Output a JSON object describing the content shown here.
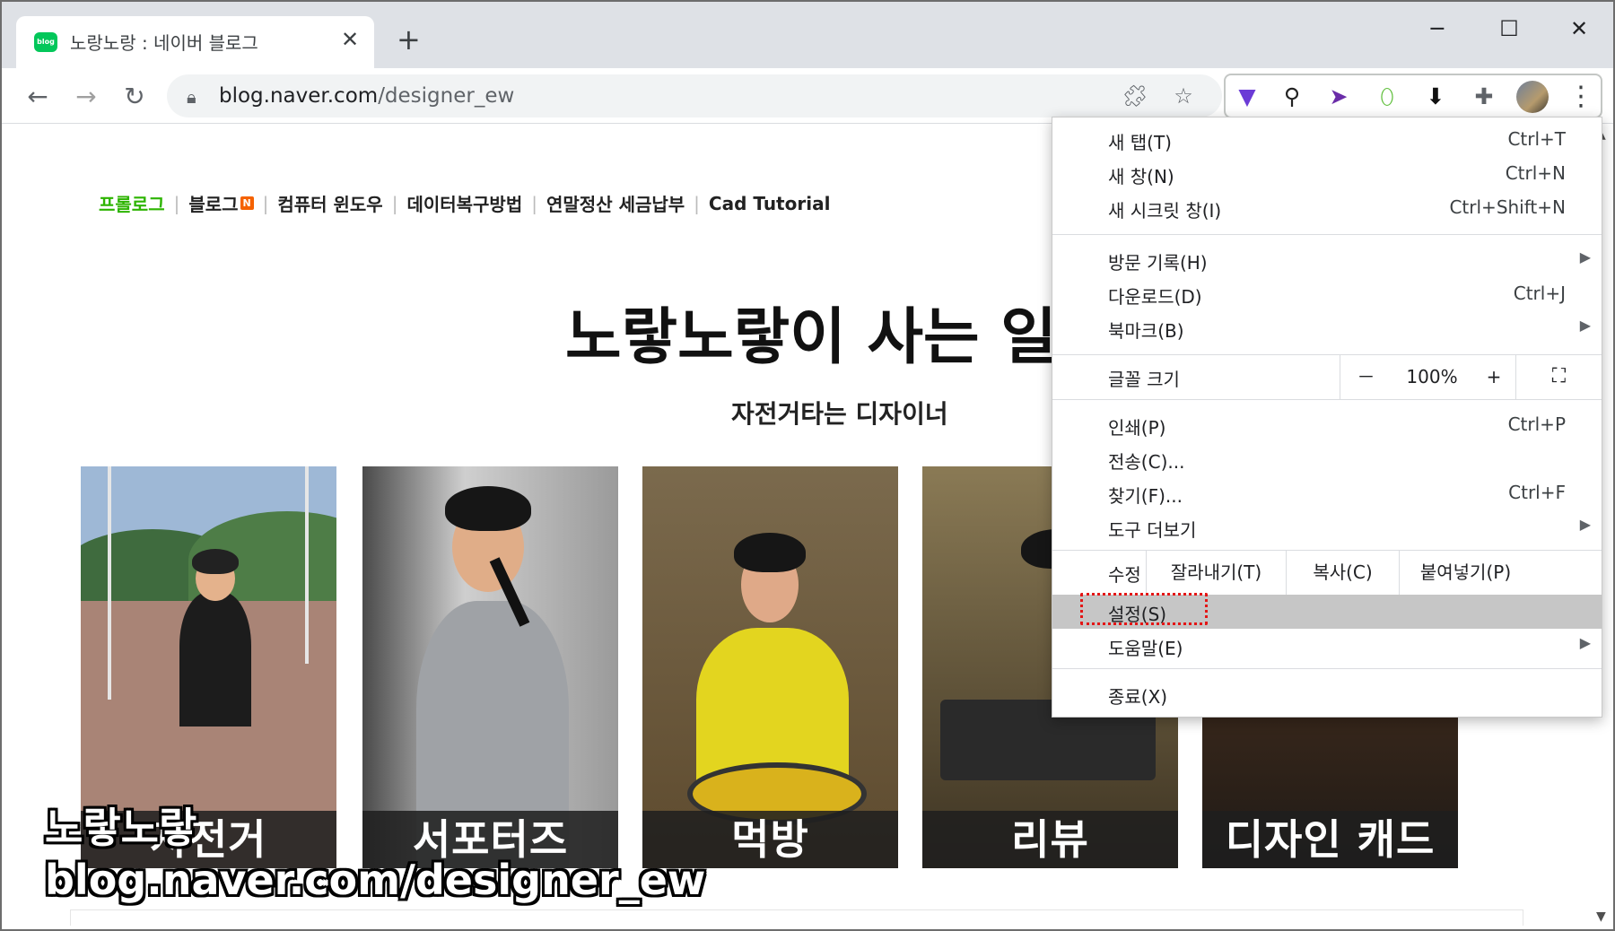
{
  "browser": {
    "tab_title": "노랑노랑 : 네이버 블로그",
    "favicon_text": "blog",
    "url_host": "blog.naver.com",
    "url_path": "/designer_ew"
  },
  "page": {
    "nav_items": [
      "프롤로그",
      "블로그",
      "컴퓨터 윈도우",
      "데이터복구방법",
      "연말정산 세금납부",
      "Cad Tutorial"
    ],
    "new_badge": "N",
    "title": "노랗노랗이 사는 일",
    "subtitle": "자전거타는 디자이너",
    "cards": [
      "자전거",
      "서포터즈",
      "먹방",
      "리뷰",
      "디자인 캐드"
    ],
    "watermark_line1": "노랗노랗",
    "watermark_line2": "blog.naver.com/designer_ew"
  },
  "menu": {
    "new_tab": {
      "label": "새 탭(T)",
      "shortcut": "Ctrl+T"
    },
    "new_window": {
      "label": "새 창(N)",
      "shortcut": "Ctrl+N"
    },
    "new_incognito": {
      "label": "새 시크릿 창(I)",
      "shortcut": "Ctrl+Shift+N"
    },
    "history": {
      "label": "방문 기록(H)"
    },
    "downloads": {
      "label": "다운로드(D)",
      "shortcut": "Ctrl+J"
    },
    "bookmarks": {
      "label": "북마크(B)"
    },
    "zoom": {
      "label": "글꼴 크기",
      "minus": "－",
      "value": "100%",
      "plus": "+"
    },
    "print": {
      "label": "인쇄(P)",
      "shortcut": "Ctrl+P"
    },
    "cast": {
      "label": "전송(C)..."
    },
    "find": {
      "label": "찾기(F)...",
      "shortcut": "Ctrl+F"
    },
    "more_tools": {
      "label": "도구 더보기"
    },
    "edit": {
      "label": "수정",
      "cut": "잘라내기(T)",
      "copy": "복사(C)",
      "paste": "붙여넣기(P)"
    },
    "settings": {
      "label": "설정(S)"
    },
    "help": {
      "label": "도움말(E)"
    },
    "exit": {
      "label": "종료(X)"
    }
  },
  "colors": {
    "accent_green": "#03c75a",
    "highlight_red": "#e31616",
    "menu_highlight": "#c6c6c6"
  },
  "icons": [
    "blog-favicon",
    "close-icon",
    "plus-icon",
    "minimize-icon",
    "maximize-icon",
    "back-icon",
    "forward-icon",
    "reload-icon",
    "lock-icon",
    "extension-blocked-icon",
    "star-icon",
    "vpn-extension-icon",
    "cycling-extension-icon",
    "cursor-extension-icon",
    "mouse-extension-icon",
    "download-extension-icon",
    "puzzle-icon",
    "more-vert-icon",
    "fullscreen-icon"
  ]
}
